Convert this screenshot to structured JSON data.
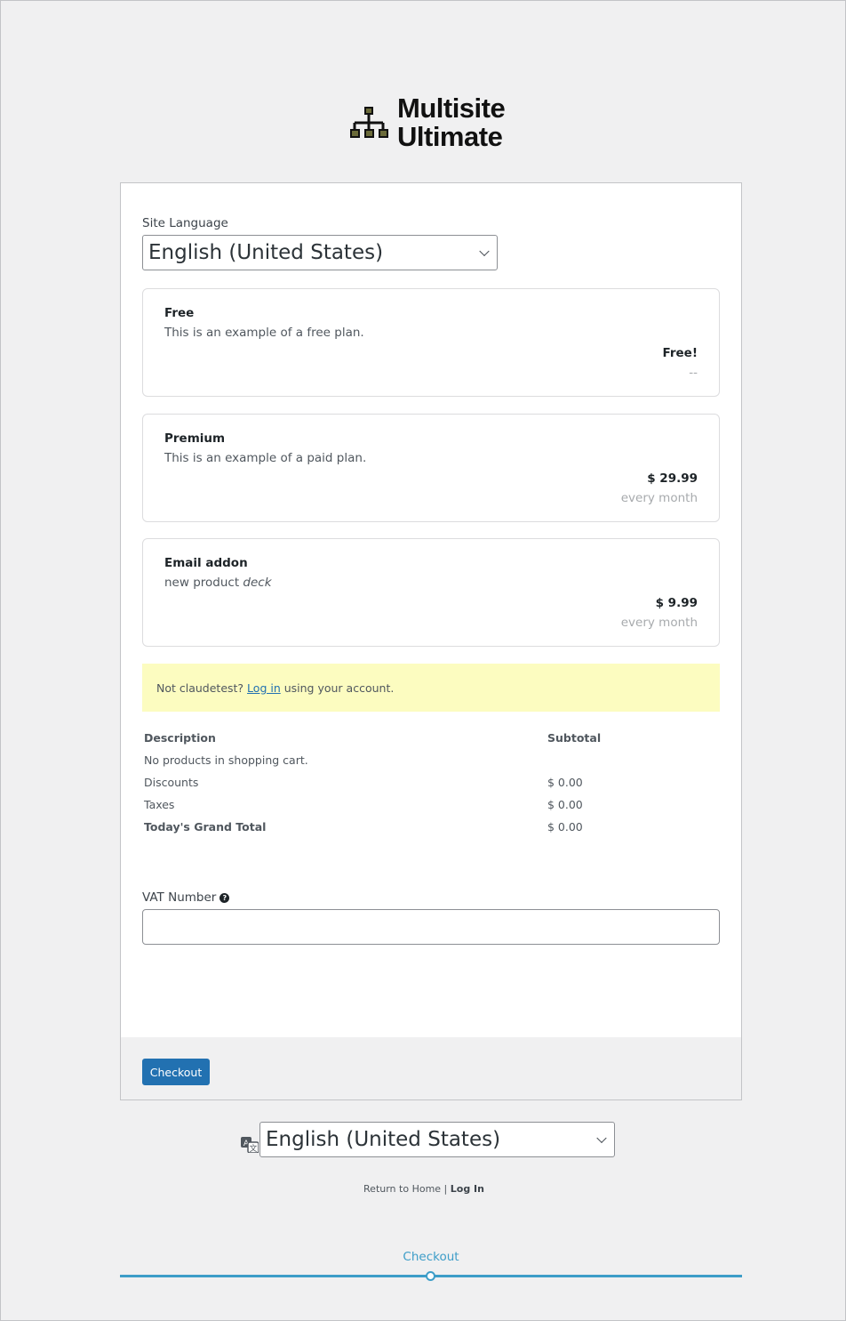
{
  "logo": {
    "line1": "Multisite",
    "line2": "Ultimate"
  },
  "form": {
    "site_language_label": "Site Language",
    "site_language_value": "English (United States)"
  },
  "plans": [
    {
      "name": "Free",
      "description": "This is an example of a free plan.",
      "price": "Free!",
      "period": "--"
    },
    {
      "name": "Premium",
      "description": "This is an example of a paid plan.",
      "price": "$ 29.99",
      "period": "every month"
    },
    {
      "name": "Email addon",
      "description_prefix": "new product ",
      "description_emphasis": "deck",
      "price": "$ 9.99",
      "period": "every month"
    }
  ],
  "notice": {
    "prefix": "Not claudetest? ",
    "link": "Log in",
    "suffix": " using your account."
  },
  "cart": {
    "col_description": "Description",
    "col_subtotal": "Subtotal",
    "empty_message": "No products in shopping cart.",
    "discounts_label": "Discounts",
    "discounts_value": "$ 0.00",
    "taxes_label": "Taxes",
    "taxes_value": "$ 0.00",
    "total_label": "Today's Grand Total",
    "total_value": "$ 0.00"
  },
  "vat": {
    "label": "VAT Number",
    "help": "?",
    "value": ""
  },
  "footer_button": {
    "label": "Checkout"
  },
  "bottom": {
    "language_value": "English (United States)",
    "return_home": "Return to Home",
    "separator": " | ",
    "login": "Log In"
  },
  "steps": {
    "current": "Checkout"
  },
  "colors": {
    "accent": "#2271b1",
    "step": "#3d9dc8",
    "notice_bg": "#fcfcc0"
  }
}
